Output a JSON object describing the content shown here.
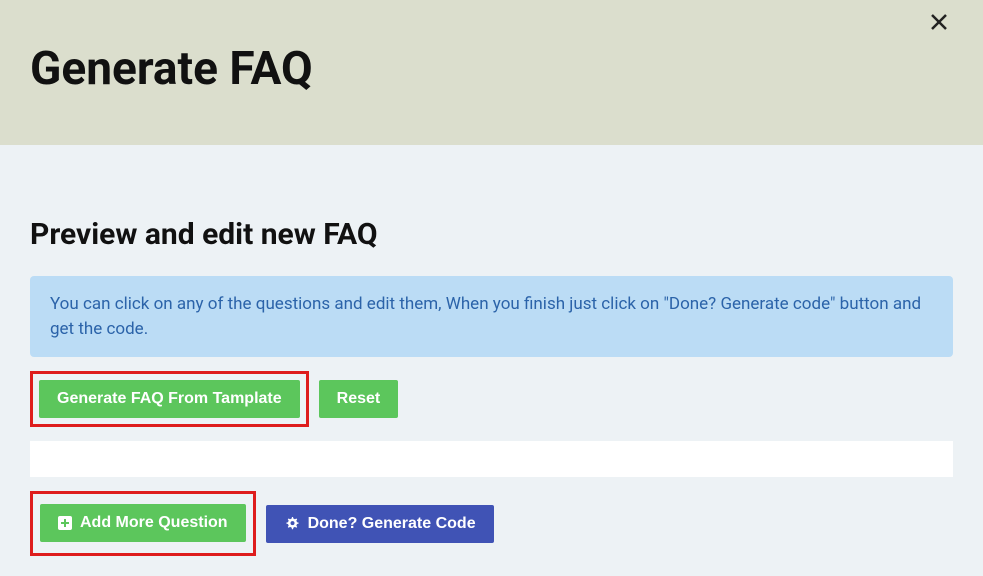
{
  "header": {
    "title": "Generate FAQ"
  },
  "section": {
    "title": "Preview and edit new FAQ",
    "info_text": "You can click on any of the questions and edit them, When you finish just click on \"Done? Generate code\" button and get the code."
  },
  "buttons": {
    "generate_from_template": "Generate FAQ From Tamplate",
    "reset": "Reset",
    "add_more_question": "Add More Question",
    "done_generate_code": "Done? Generate Code"
  }
}
